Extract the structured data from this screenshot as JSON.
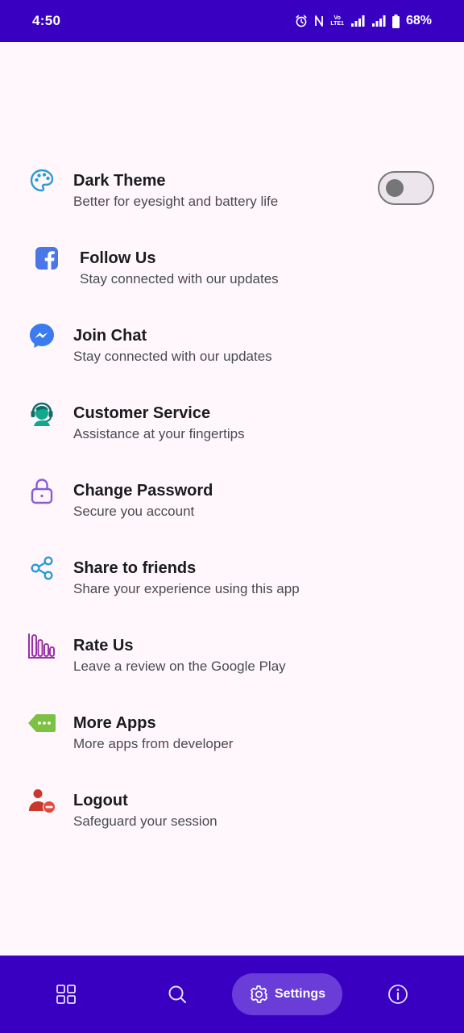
{
  "status_bar": {
    "time": "4:50",
    "lte_label": "LTE1",
    "battery": "68%"
  },
  "settings": [
    {
      "title": "Dark Theme",
      "subtitle": "Better for eyesight and battery life",
      "icon": "palette-icon",
      "color": "#2B9BD3"
    },
    {
      "title": "Follow Us",
      "subtitle": "Stay connected with our updates",
      "icon": "facebook-icon",
      "color": "#4A76E8"
    },
    {
      "title": "Join Chat",
      "subtitle": "Stay connected with our updates",
      "icon": "messenger-icon",
      "color": "#3B7BF0"
    },
    {
      "title": "Customer Service",
      "subtitle": "Assistance at your fingertips",
      "icon": "headset-icon",
      "color": "#12A88C"
    },
    {
      "title": "Change Password",
      "subtitle": "Secure you account",
      "icon": "lock-icon",
      "color": "#8A5AD8"
    },
    {
      "title": "Share to friends",
      "subtitle": "Share your experience using this app",
      "icon": "share-icon",
      "color": "#2B9BD3"
    },
    {
      "title": "Rate Us",
      "subtitle": "Leave a review on the Google Play",
      "icon": "bar-chart-icon",
      "color": "#9A2FA8"
    },
    {
      "title": "More Apps",
      "subtitle": "More apps from developer",
      "icon": "tag-icon",
      "color": "#7CC142"
    },
    {
      "title": "Logout",
      "subtitle": "Safeguard your session",
      "icon": "user-remove-icon",
      "color": "#E8473A"
    }
  ],
  "dark_theme_enabled": false,
  "bottom_nav": {
    "items": [
      {
        "icon": "grid-icon",
        "label": ""
      },
      {
        "icon": "search-icon",
        "label": ""
      },
      {
        "icon": "gear-icon",
        "label": "Settings",
        "active": true
      },
      {
        "icon": "info-icon",
        "label": ""
      }
    ]
  },
  "colors": {
    "brand": "#3A00C2",
    "active_pill": "#6A3CD8",
    "background": "#FFF7FC"
  }
}
